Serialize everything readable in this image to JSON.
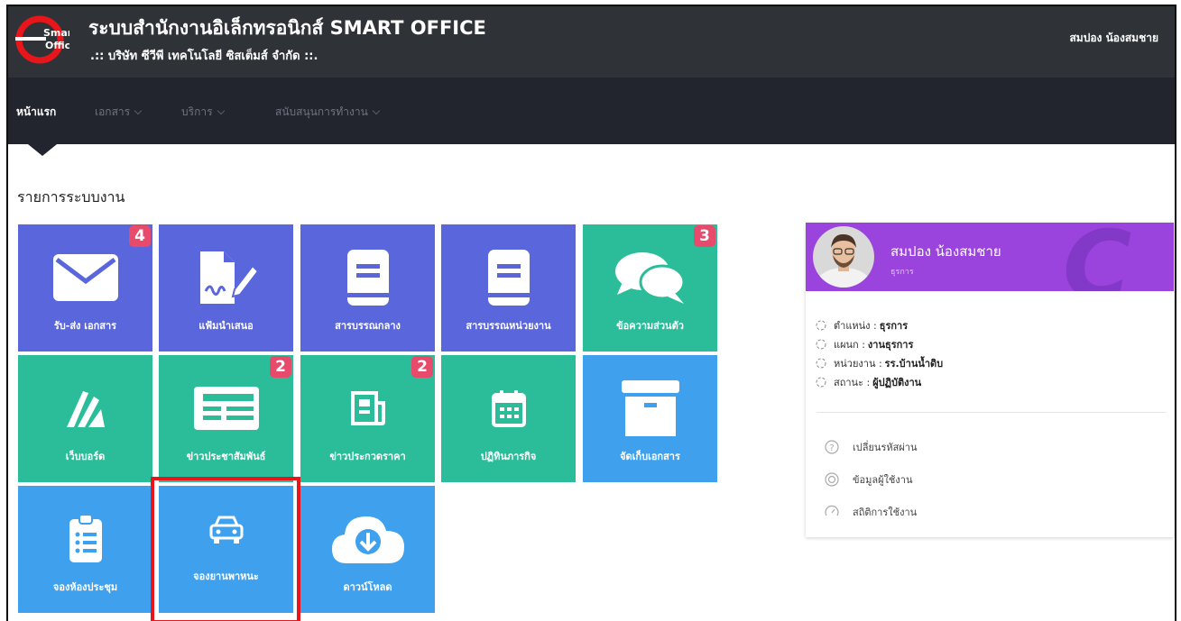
{
  "header": {
    "title": "ระบบสำนักงานอิเล็กทรอนิกส์ SMART OFFICE",
    "company": ".:: บริษัท ซีวีพี เทคโนโลยี ซิสเต็มส์ จำกัด ::.",
    "user": "สมปอง น้องสมชาย",
    "logo_text_1": "Smart",
    "logo_text_2": "Office"
  },
  "nav": {
    "items": [
      {
        "label": "หน้าแรก",
        "active": true
      },
      {
        "label": "เอกสาร",
        "dropdown": true
      },
      {
        "label": "บริการ",
        "dropdown": true
      },
      {
        "label": "สนับสนุนการทำงาน",
        "dropdown": true
      }
    ]
  },
  "section": {
    "title": "รายการระบบงาน"
  },
  "tiles": [
    {
      "label": "รับ-ส่ง เอกสาร",
      "icon": "envelope-icon",
      "color": "#5a66dc",
      "badge": "4"
    },
    {
      "label": "แฟ้มนำเสนอ",
      "icon": "document-sign-icon",
      "color": "#5a66dc"
    },
    {
      "label": "สารบรรณกลาง",
      "icon": "book-icon",
      "color": "#5a66dc"
    },
    {
      "label": "สารบรรณหน่วยงาน",
      "icon": "book-icon",
      "color": "#5a66dc"
    },
    {
      "label": "ข้อความส่วนตัว",
      "icon": "chat-bubbles-icon",
      "color": "#2bbd99",
      "badge": "3"
    },
    {
      "label": "เว็บบอร์ด",
      "icon": "webboard-icon",
      "color": "#2bbd99"
    },
    {
      "label": "ข่าวประชาสัมพันธ์",
      "icon": "newspaper-icon",
      "color": "#2bbd99",
      "badge": "2"
    },
    {
      "label": "ข่าวประกวดราคา",
      "icon": "newspaper-small-icon",
      "color": "#2bbd99",
      "badge": "2"
    },
    {
      "label": "ปฏิทินภารกิจ",
      "icon": "calendar-icon",
      "color": "#2bbd99"
    },
    {
      "label": "จัดเก็บเอกสาร",
      "icon": "archive-box-icon",
      "color": "#3fa1ee"
    },
    {
      "label": "จองห้องประชุม",
      "icon": "clipboard-list-icon",
      "color": "#3fa1ee"
    },
    {
      "label": "จองยานพาหนะ",
      "icon": "car-icon",
      "color": "#3fa1ee",
      "highlighted": true
    },
    {
      "label": "ดาวน์โหลด",
      "icon": "cloud-download-icon",
      "color": "#3fa1ee"
    }
  ],
  "profile": {
    "name": "สมปอง น้องสมชาย",
    "role": "ธุรการ",
    "info": [
      {
        "key": "ตำแหน่ง : ",
        "value": "ธุรการ"
      },
      {
        "key": "แผนก : ",
        "value": "งานธุรการ"
      },
      {
        "key": "หน่วยงาน : ",
        "value": "รร.บ้านน้ำดิบ"
      },
      {
        "key": "สถานะ : ",
        "value": "ผู้ปฏิบัติงาน"
      }
    ],
    "menu": [
      {
        "label": "เปลี่ยนรหัสผ่าน",
        "icon": "question-circle-icon"
      },
      {
        "label": "ข้อมูลผู้ใช้งาน",
        "icon": "lifebuoy-icon"
      },
      {
        "label": "สถิติการใช้งาน",
        "icon": "gauge-icon"
      }
    ]
  }
}
